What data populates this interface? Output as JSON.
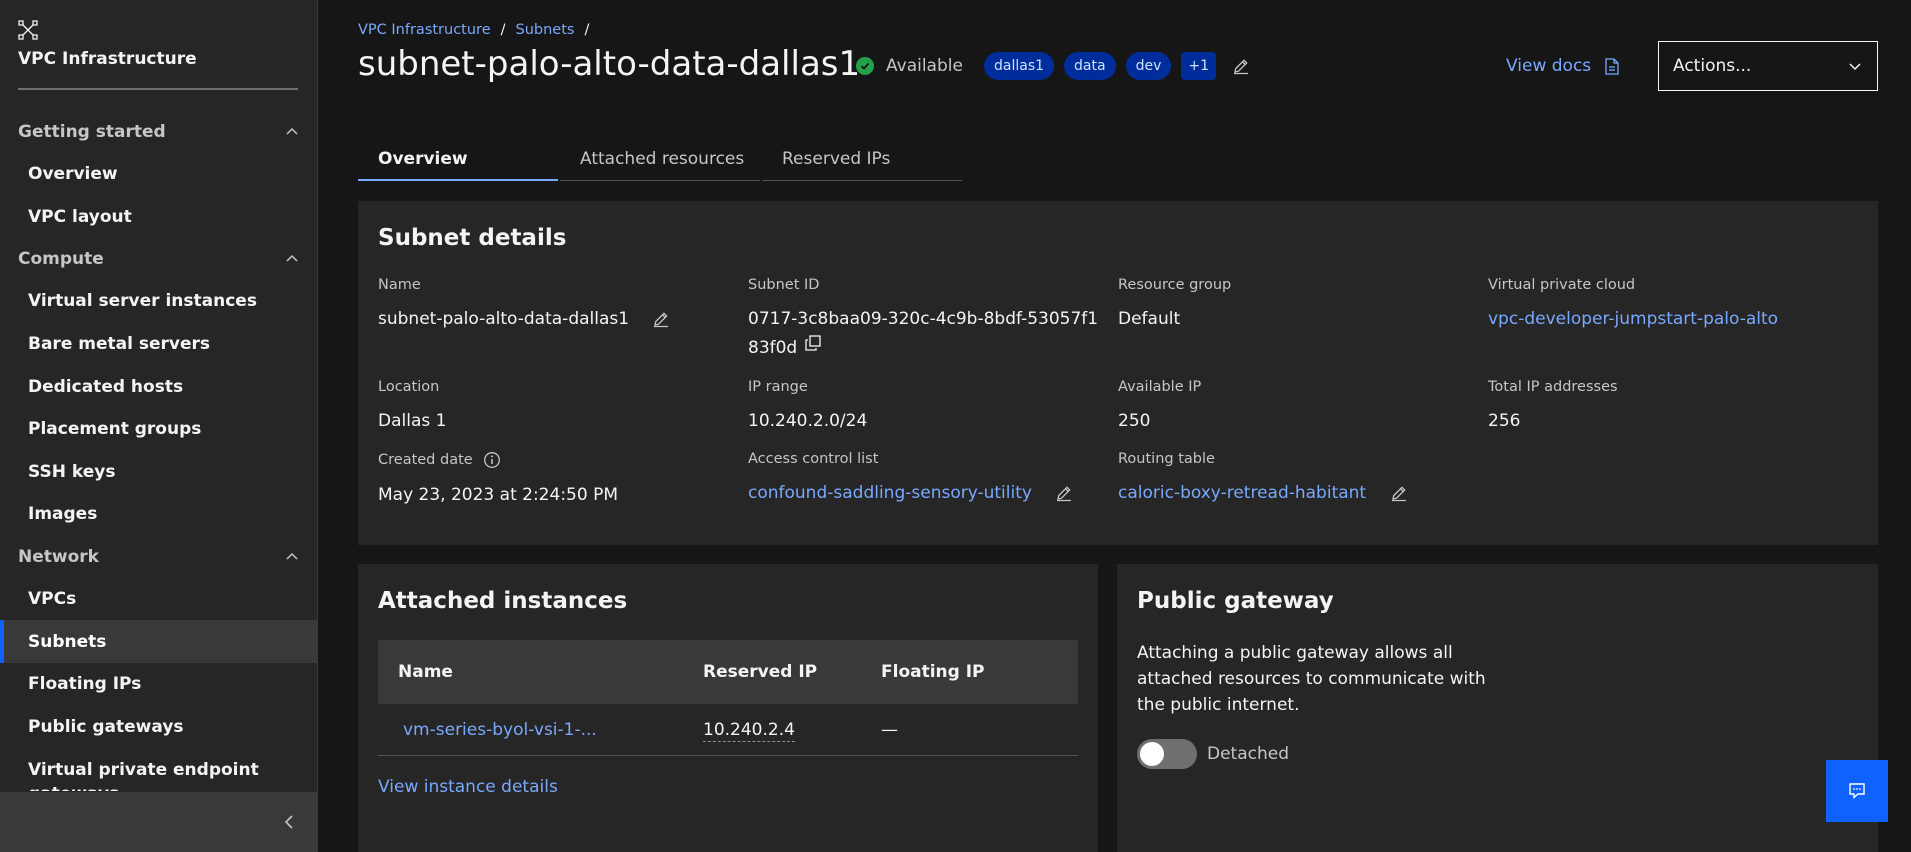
{
  "sidebar": {
    "title": "VPC Infrastructure",
    "groups": [
      {
        "label": "Getting started",
        "items": [
          "Overview",
          "VPC layout"
        ]
      },
      {
        "label": "Compute",
        "items": [
          "Virtual server instances",
          "Bare metal servers",
          "Dedicated hosts",
          "Placement groups",
          "SSH keys",
          "Images"
        ]
      },
      {
        "label": "Network",
        "items": [
          "VPCs",
          "Subnets",
          "Floating IPs",
          "Public gateways",
          "Virtual private endpoint gateways"
        ]
      }
    ],
    "active_item": "Subnets"
  },
  "breadcrumb": {
    "items": [
      "VPC Infrastructure",
      "Subnets"
    ],
    "separator": "/"
  },
  "header": {
    "title": "subnet-palo-alto-data-dallas1",
    "status": "Available",
    "tags": [
      "dallas1",
      "data",
      "dev"
    ],
    "more_tags": "+1",
    "view_docs": "View docs",
    "actions": "Actions..."
  },
  "tabs": [
    "Overview",
    "Attached resources",
    "Reserved IPs"
  ],
  "details": {
    "title": "Subnet details",
    "name_label": "Name",
    "name_value": "subnet-palo-alto-data-dallas1",
    "subnet_id_label": "Subnet ID",
    "subnet_id_line1": "0717-3c8baa09-320c-4c9b-8bdf-53057f1",
    "subnet_id_line2": "83f0d",
    "resource_group_label": "Resource group",
    "resource_group_value": "Default",
    "vpc_label": "Virtual private cloud",
    "vpc_value": "vpc-developer-jumpstart-palo-alto",
    "location_label": "Location",
    "location_value": "Dallas 1",
    "ip_range_label": "IP range",
    "ip_range_value": "10.240.2.0/24",
    "available_ip_label": "Available IP",
    "available_ip_value": "250",
    "total_ip_label": "Total IP addresses",
    "total_ip_value": "256",
    "created_label": "Created date",
    "created_value": "May 23, 2023 at 2:24:50 PM",
    "acl_label": "Access control list",
    "acl_value": "confound-saddling-sensory-utility",
    "routing_label": "Routing table",
    "routing_value": "caloric-boxy-retread-habitant"
  },
  "instances": {
    "title": "Attached instances",
    "columns": [
      "Name",
      "Reserved IP",
      "Floating IP"
    ],
    "rows": [
      {
        "name": "vm-series-byol-vsi-1-...",
        "reserved_ip": "10.240.2.4",
        "floating_ip": "—"
      }
    ],
    "view_details": "View instance details"
  },
  "gateway": {
    "title": "Public gateway",
    "description": "Attaching a public gateway allows all attached resources to communicate with the public internet.",
    "toggle_label": "Detached",
    "toggle_on": false
  },
  "colors": {
    "accent": "#0f62fe",
    "link": "#78a9ff",
    "success": "#24a148",
    "tag_bg": "#002d9c"
  }
}
